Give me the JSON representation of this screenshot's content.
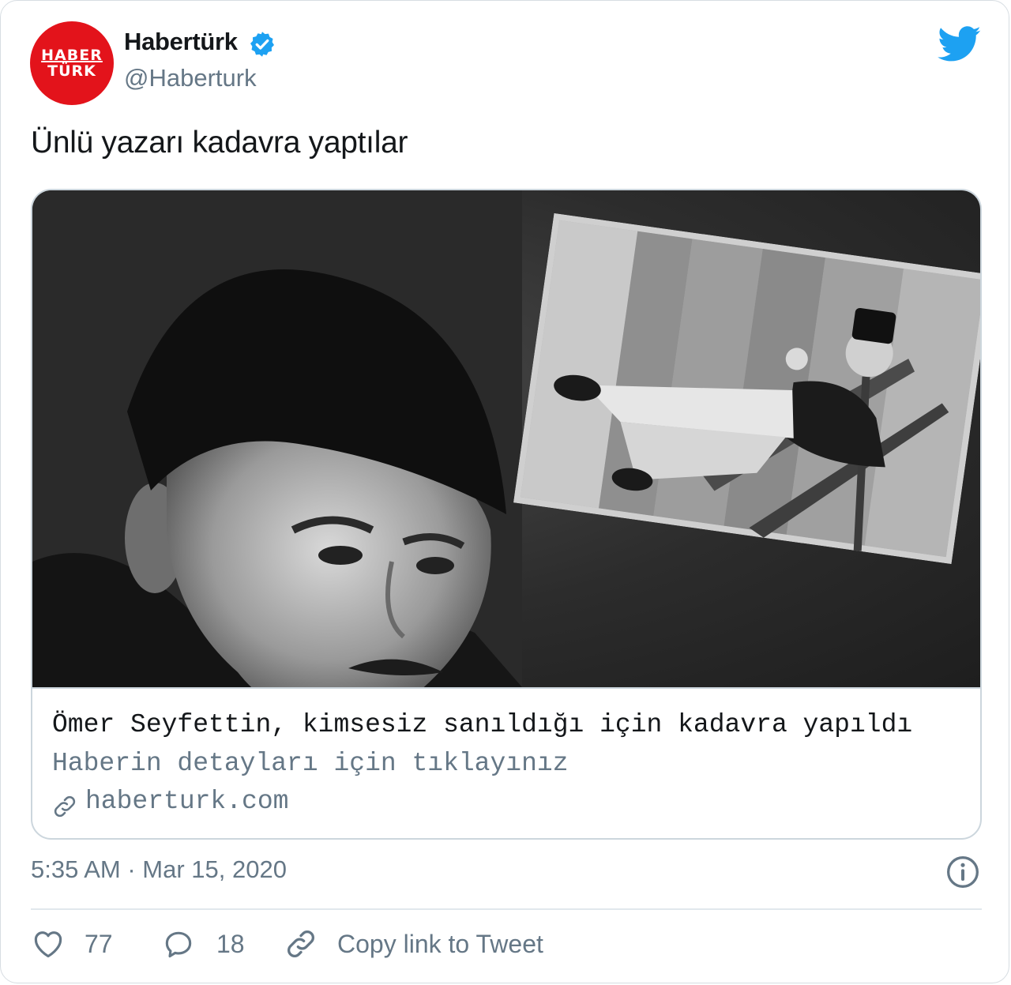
{
  "author": {
    "avatar_text_line1": "HABER",
    "avatar_text_line2": "TÜRK",
    "display_name": "Habertürk",
    "handle": "@Haberturk",
    "verified": true
  },
  "tweet": {
    "text": "Ünlü yazarı kadavra yaptılar"
  },
  "card": {
    "title": "Ömer Seyfettin, kimsesiz sanıldığı için kadavra yapıldı",
    "description": "Haberin detayları için tıklayınız",
    "domain": "haberturk.com"
  },
  "meta": {
    "timestamp": "5:35 AM · Mar 15, 2020"
  },
  "actions": {
    "like_count": "77",
    "reply_count": "18",
    "copy_link_label": "Copy link to Tweet"
  },
  "icons": {
    "brand": "twitter-bird-icon",
    "verified": "verified-badge-icon",
    "info": "info-icon",
    "like": "heart-icon",
    "reply": "reply-bubble-icon",
    "link": "link-icon"
  },
  "colors": {
    "twitter_blue": "#1da1f2",
    "avatar_red": "#e3131b",
    "secondary_text": "#657786",
    "primary_text": "#14171a"
  }
}
